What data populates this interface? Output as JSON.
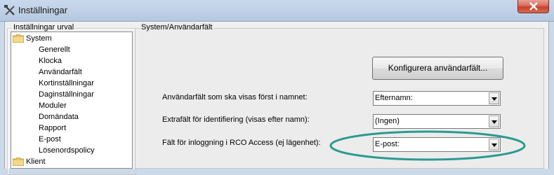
{
  "window": {
    "title": "Inställningar",
    "colors": {
      "highlight_ring": "#2a9a92",
      "close_button": "#c7412b"
    }
  },
  "tree": {
    "legend": "Inställningar urval",
    "items": [
      {
        "label": "System",
        "level": 0,
        "folder": true
      },
      {
        "label": "Generellt",
        "level": 1
      },
      {
        "label": "Klocka",
        "level": 1
      },
      {
        "label": "Användarfält",
        "level": 1
      },
      {
        "label": "Kortinställningar",
        "level": 1
      },
      {
        "label": "Daginställningar",
        "level": 1
      },
      {
        "label": "Moduler",
        "level": 1
      },
      {
        "label": "Domändata",
        "level": 1
      },
      {
        "label": "Rapport",
        "level": 1
      },
      {
        "label": "E-post",
        "level": 1
      },
      {
        "label": "Lösenordspolicy",
        "level": 1
      },
      {
        "label": "Klient",
        "level": 0,
        "folder": true
      }
    ]
  },
  "panel": {
    "legend": "System/Användarfält",
    "configure_button": "Konfigurera användarfält...",
    "fields": [
      {
        "label": "Användarfält som ska visas först i namnet:",
        "value": "Efternamn:"
      },
      {
        "label": "Extrafält för identifiering (visas efter namn):",
        "value": "(Ingen)"
      },
      {
        "label": "Fält för inloggning i RCO Access (ej lägenhet):",
        "value": "E-post:"
      }
    ]
  }
}
